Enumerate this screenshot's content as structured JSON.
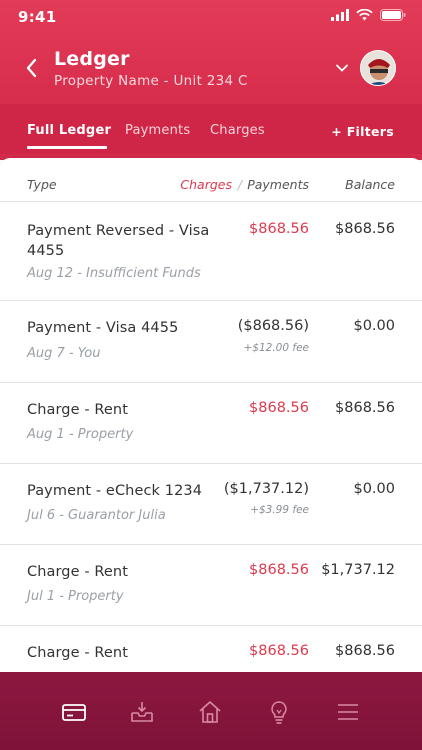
{
  "status": {
    "time": "9:41"
  },
  "header": {
    "title": "Ledger",
    "subtitle": "Property Name - Unit 234 C"
  },
  "tabs": [
    {
      "label": "Full Ledger",
      "active": true
    },
    {
      "label": "Payments",
      "active": false
    },
    {
      "label": "Charges",
      "active": false
    }
  ],
  "filters_label": "+ Filters",
  "columns": {
    "type": "Type",
    "charges": "Charges",
    "separator": "/",
    "payments": "Payments",
    "balance": "Balance"
  },
  "rows": [
    {
      "desc": "Payment Reversed - Visa 4455",
      "sub": "Aug 12 - Insufficient Funds",
      "amount": "$868.56",
      "kind": "charge",
      "fee": "",
      "balance": "$868.56"
    },
    {
      "desc": "Payment - Visa 4455",
      "sub": "Aug 7 - You",
      "amount": "($868.56)",
      "kind": "payment",
      "fee": "+$12.00 fee",
      "balance": "$0.00"
    },
    {
      "desc": "Charge - Rent",
      "sub": "Aug 1 - Property",
      "amount": "$868.56",
      "kind": "charge",
      "fee": "",
      "balance": "$868.56"
    },
    {
      "desc": "Payment - eCheck 1234",
      "sub": "Jul 6 - Guarantor Julia",
      "amount": "($1,737.12)",
      "kind": "payment",
      "fee": "+$3.99 fee",
      "balance": "$0.00"
    },
    {
      "desc": "Charge - Rent",
      "sub": "Jul 1 - Property",
      "amount": "$868.56",
      "kind": "charge",
      "fee": "",
      "balance": "$1,737.12"
    },
    {
      "desc": "Charge - Rent",
      "sub": "",
      "amount": "$868.56",
      "kind": "charge",
      "fee": "",
      "balance": "$868.56"
    }
  ],
  "bottom_nav": [
    {
      "icon": "card-icon"
    },
    {
      "icon": "inbox-download-icon"
    },
    {
      "icon": "home-icon"
    },
    {
      "icon": "lightbulb-icon"
    },
    {
      "icon": "menu-icon"
    }
  ],
  "colors": {
    "brand": "#d92f4e",
    "charge": "#de3a4e",
    "nav": "#861540"
  }
}
